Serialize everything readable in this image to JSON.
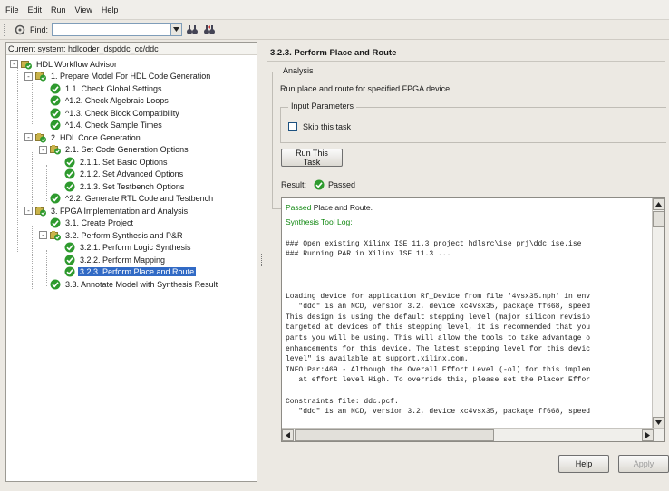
{
  "menubar": {
    "items": [
      "File",
      "Edit",
      "Run",
      "View",
      "Help"
    ]
  },
  "toolbar": {
    "find_label": "Find:",
    "find_value": "",
    "icons": [
      "run-icon",
      "find-next-icon",
      "find-prev-icon"
    ]
  },
  "tree": {
    "current_system": "Current system: hdlcoder_dspddc_cc/ddc",
    "nodes": [
      {
        "label": "HDL Workflow Advisor",
        "level": 0,
        "expander": "-",
        "icon": "advisor"
      },
      {
        "label": "1. Prepare Model For HDL Code Generation",
        "level": 1,
        "expander": "-",
        "icon": "folder"
      },
      {
        "label": "1.1. Check Global Settings",
        "level": 2,
        "expander": "",
        "icon": "check"
      },
      {
        "label": "^1.2. Check Algebraic Loops",
        "level": 2,
        "expander": "",
        "icon": "check"
      },
      {
        "label": "^1.3. Check Block Compatibility",
        "level": 2,
        "expander": "",
        "icon": "check"
      },
      {
        "label": "^1.4. Check Sample Times",
        "level": 2,
        "expander": "",
        "icon": "check"
      },
      {
        "label": "2. HDL Code Generation",
        "level": 1,
        "expander": "-",
        "icon": "folder"
      },
      {
        "label": "2.1. Set Code Generation Options",
        "level": 2,
        "expander": "-",
        "icon": "folder"
      },
      {
        "label": "2.1.1. Set Basic Options",
        "level": 3,
        "expander": "",
        "icon": "check"
      },
      {
        "label": "2.1.2. Set Advanced Options",
        "level": 3,
        "expander": "",
        "icon": "check"
      },
      {
        "label": "2.1.3. Set Testbench Options",
        "level": 3,
        "expander": "",
        "icon": "check"
      },
      {
        "label": "^2.2. Generate RTL Code and Testbench",
        "level": 2,
        "expander": "",
        "icon": "check"
      },
      {
        "label": "3. FPGA Implementation and Analysis",
        "level": 1,
        "expander": "-",
        "icon": "folder"
      },
      {
        "label": "3.1. Create Project",
        "level": 2,
        "expander": "",
        "icon": "check"
      },
      {
        "label": "3.2. Perform Synthesis and P&R",
        "level": 2,
        "expander": "-",
        "icon": "folder"
      },
      {
        "label": "3.2.1. Perform Logic Synthesis",
        "level": 3,
        "expander": "",
        "icon": "check"
      },
      {
        "label": "3.2.2. Perform Mapping",
        "level": 3,
        "expander": "",
        "icon": "check"
      },
      {
        "label": "3.2.3. Perform Place and Route",
        "level": 3,
        "expander": "",
        "icon": "check",
        "selected": true
      },
      {
        "label": "3.3. Annotate Model with Synthesis Result",
        "level": 2,
        "expander": "",
        "icon": "check"
      }
    ]
  },
  "task": {
    "title": "3.2.3. Perform Place and Route",
    "analysis_legend": "Analysis",
    "analysis_desc": "Run place and route for specified FPGA device",
    "input_legend": "Input Parameters",
    "skip_label": "Skip this task",
    "skip_checked": false,
    "run_button": "Run This Task",
    "result_label": "Result:",
    "result_value": "Passed"
  },
  "log": {
    "passed_word": "Passed",
    "passed_rest": " Place and Route.",
    "tool_log_label": "Synthesis Tool Log:",
    "lines": [
      "",
      "### Open existing Xilinx ISE 11.3 project hdlsrc\\ise_prj\\ddc_ise.ise",
      "### Running PAR in Xilinx ISE 11.3 ...",
      "",
      "",
      "",
      "Loading device for application Rf_Device from file '4vsx35.nph' in env",
      "   \"ddc\" is an NCD, version 3.2, device xc4vsx35, package ff668, speed",
      "This design is using the default stepping level (major silicon revisio",
      "targeted at devices of this stepping level, it is recommended that you",
      "parts you will be using. This will allow the tools to take advantage o",
      "enhancements for this device. The latest stepping level for this devic",
      "level\" is available at support.xilinx.com.",
      "INFO:Par:469 - Although the Overall Effort Level (-ol) for this implem",
      "   at effort level High. To override this, please set the Placer Effor",
      "",
      "Constraints file: ddc.pcf.",
      "   \"ddc\" is an NCD, version 3.2, device xc4vsx35, package ff668, speed"
    ]
  },
  "buttons": {
    "help": "Help",
    "apply": "Apply"
  },
  "colors": {
    "selection": "#316ac5",
    "passed_green": "#118811",
    "check_green": "#2e9a2e"
  }
}
